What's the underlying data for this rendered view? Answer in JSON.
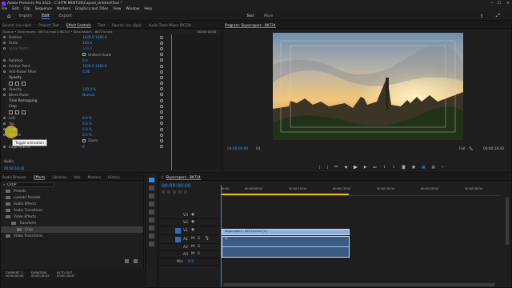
{
  "window": {
    "title": "Adobe Premiere Pro 2022 - C:\\HTM MENTOR\\Copied_Untitled\\Text *"
  },
  "menu": [
    "File",
    "Edit",
    "Clip",
    "Sequence",
    "Markers",
    "Graphics and Titles",
    "View",
    "Window",
    "Help"
  ],
  "workspaces": [
    {
      "label": "Import"
    },
    {
      "label": "Edit",
      "active": true
    },
    {
      "label": "Export"
    }
  ],
  "header_right": {
    "text_label": "Text",
    "more_label": "More"
  },
  "source_panel": {
    "tabs": [
      {
        "label": "Source: (no clips)"
      },
      {
        "label": "Project: Text"
      },
      {
        "label": "Effect Controls",
        "active": true
      },
      {
        "label": "Text"
      },
      {
        "label": "Source: (no clips)"
      },
      {
        "label": "Audio Track Mixer: BK724"
      }
    ],
    "clip_path": "Source • Skyscrapers - BK724.mp4 ▸ BK724 • Skyscrapers - BK724.mp4",
    "timecode": "00:00:15:00",
    "properties": [
      {
        "name": "Position",
        "v1": "1920.0",
        "v2": "1080.0"
      },
      {
        "name": "Scale",
        "v1": "100.0"
      },
      {
        "name": "Scale Width",
        "v1": "100.0",
        "dim": true
      },
      {
        "name": "",
        "checkbox": "Uniform Scale"
      },
      {
        "name": "Rotation",
        "v1": "0.0"
      },
      {
        "name": "Anchor Point",
        "v1": "1920.0",
        "v2": "1080.0"
      },
      {
        "name": "Anti-flicker Filter",
        "v1": "0.00"
      },
      {
        "name": "Opacity",
        "section": true
      },
      {
        "name": "",
        "masks": true
      },
      {
        "name": "Opacity",
        "v1": "100.0 %"
      },
      {
        "name": "Blend Mode",
        "v1": "Normal"
      },
      {
        "name": "Time Remapping",
        "section": true
      },
      {
        "name": "Crop",
        "section": true
      },
      {
        "name": "",
        "masks": true
      },
      {
        "name": "Left",
        "v1": "0.0 %"
      },
      {
        "name": "Top",
        "v1": "0.0 %"
      },
      {
        "name": "Right",
        "v1": "0.0 %"
      },
      {
        "name": "Bottom",
        "v1": "0.0 %"
      },
      {
        "name": "",
        "checkbox": "Zoom"
      },
      {
        "name": "Edge Feather",
        "v1": "0"
      }
    ],
    "tooltip": "Toggle animation",
    "audio_label": "Audio",
    "footer_timecode": "00:00:18:42"
  },
  "program": {
    "title": "Program: Skyscrapers - BK724",
    "timecode_left": "00:00:00:00",
    "fit": "Fit",
    "quality": "Full",
    "timecode_right": "00:00:18:42"
  },
  "effects_panel": {
    "tabs": [
      {
        "label": "Audio Browser"
      },
      {
        "label": "Effects",
        "active": true
      },
      {
        "label": "Libraries"
      },
      {
        "label": "Info"
      },
      {
        "label": "Markers"
      },
      {
        "label": "History"
      }
    ],
    "search": "CROP",
    "items": [
      {
        "label": "Presets",
        "indent": 0
      },
      {
        "label": "Lumetri Presets",
        "indent": 0
      },
      {
        "label": "Audio Effects",
        "indent": 0
      },
      {
        "label": "Audio Transitions",
        "indent": 0
      },
      {
        "label": "Video Effects",
        "indent": 0
      },
      {
        "label": "Transform",
        "indent": 1
      },
      {
        "label": "Crop",
        "indent": 2,
        "selected": true
      },
      {
        "label": "Video Transitions",
        "indent": 0
      }
    ],
    "footer": {
      "current_label": "CURRENT T...",
      "current_value": "00:00:00:00",
      "duration_label": "DURATION",
      "duration_value": "00:00:18:42",
      "inout_label": "IN TO OUT",
      "inout_value": "00:00:18:42"
    }
  },
  "timeline": {
    "tab": "Skyscrapers - BK724",
    "timecode": "00:00:00:00",
    "ruler": [
      "00:00",
      "00:00:05:00",
      "00:00:10:00",
      "00:00:15:00",
      "00:00:20:00",
      "00:00:25:00",
      "00:00:30:00"
    ],
    "video_tracks": [
      "V3",
      "V2",
      "V1"
    ],
    "audio_tracks": [
      "A1",
      "A2",
      "A3"
    ],
    "mix_label": "Mix",
    "mix_value": "0.0",
    "clip_label": "Skyscrapers - BK724.mp4 [V]",
    "audio_clip_label": "fx"
  },
  "colors": {
    "accent": "#2d8ceb",
    "clip_video": "#8ab0e0",
    "clip_audio": "#3b5b82",
    "timecode": "#3a9bff",
    "work_area": "#e0c21a"
  }
}
